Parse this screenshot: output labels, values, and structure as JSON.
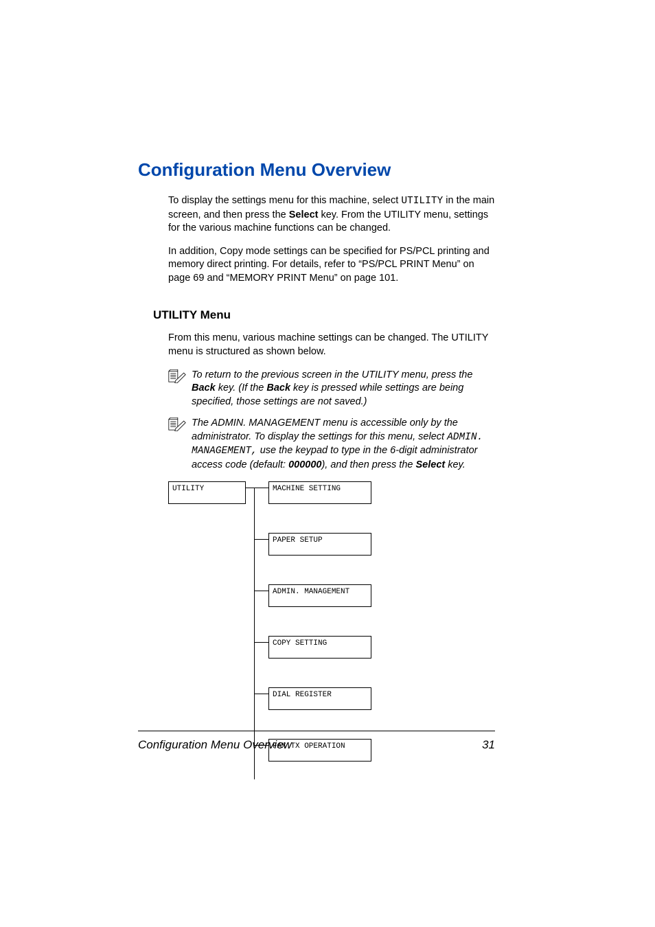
{
  "title": "Configuration Menu Overview",
  "intro": {
    "p1_pre": "To display the settings menu for this machine, select ",
    "p1_mono": "UTILITY",
    "p1_mid": " in the main screen, and then press the ",
    "p1_bold": "Select",
    "p1_post": " key. From the UTILITY menu, settings for the various machine functions can be changed.",
    "p2": "In addition, Copy mode settings can be specified for PS/PCL printing and memory direct printing. For details, refer to “PS/PCL PRINT Menu” on page 69 and “MEMORY PRINT Menu” on page 101."
  },
  "section": {
    "heading": "UTILITY Menu",
    "p1": "From this menu, various machine settings can be changed. The UTILITY menu is structured as shown below."
  },
  "notes": {
    "n1_pre": "To return to the previous screen in the UTILITY menu, press the ",
    "n1_b1": "Back",
    "n1_mid": " key. (If the ",
    "n1_b2": "Back",
    "n1_post": " key is pressed while settings are being specified, those settings are not saved.)",
    "n2_pre": "The ADMIN. MANAGEMENT menu is accessible only by the administrator. To display the settings for this menu, select ",
    "n2_mono": "ADMIN. MANAGE­MENT,",
    "n2_mid": " use the keypad to type in the 6-digit administrator access code (default: ",
    "n2_b1": "000000",
    "n2_mid2": "), and then press the ",
    "n2_b2": "Select",
    "n2_post": " key."
  },
  "diagram": {
    "root": "UTILITY",
    "items": [
      "MACHINE SETTING",
      "PAPER SETUP",
      "ADMIN. MANAGEMENT",
      "COPY SETTING",
      "DIAL REGISTER",
      "FAX TX OPERATION"
    ]
  },
  "footer": {
    "title": "Configuration Menu Overview",
    "page": "31"
  }
}
